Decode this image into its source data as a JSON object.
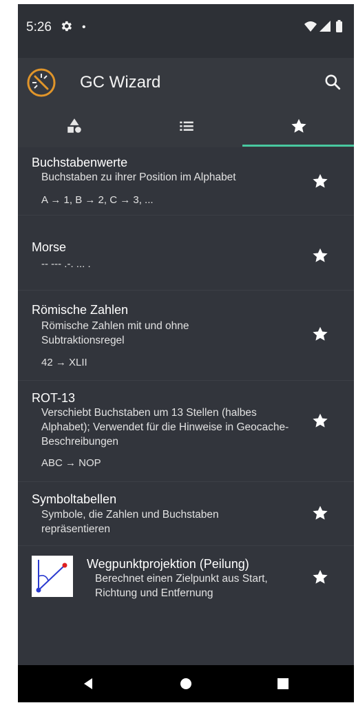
{
  "status": {
    "time": "5:26",
    "dot": "•"
  },
  "app": {
    "title": "GC Wizard"
  },
  "tabs": [
    {
      "icon": "categories-icon"
    },
    {
      "icon": "list-icon"
    },
    {
      "icon": "favorites-star-icon",
      "selected": true
    }
  ],
  "items": [
    {
      "name": "Buchstabenwerte",
      "desc": "Buchstaben zu ihrer Position im Alphabet",
      "example": "A → 1, B → 2, C → 3, ..."
    },
    {
      "name": "Morse",
      "example": "-- --- .-. ... ."
    },
    {
      "name": "Römische Zahlen",
      "desc": "Römische Zahlen mit und ohne Subtraktionsregel",
      "example": "42 → XLII"
    },
    {
      "name": "ROT-13",
      "desc": "Verschiebt Buchstaben um 13 Stellen (halbes Alphabet); Verwendet für die Hinweise in Geocache-Beschreibungen",
      "example": "ABC → NOP"
    },
    {
      "name": "Symboltabellen",
      "desc": "Symbole, die Zahlen und Buchstaben repräsentieren"
    },
    {
      "name": "Wegpunktprojektion (Peilung)",
      "desc": "Berechnet einen Zielpunkt aus Start, Richtung und Entfernung"
    }
  ],
  "colors": {
    "background": "#32353c",
    "accent": "#48c9a0",
    "text": "#ffffff"
  }
}
